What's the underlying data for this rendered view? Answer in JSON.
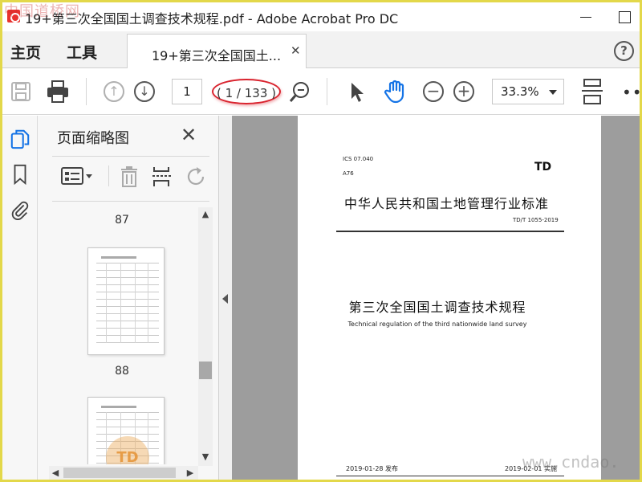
{
  "watermark": {
    "top_left": "中国道桥网",
    "bottom_right": "www.cndao."
  },
  "window": {
    "title": "19+第三次全国国土调查技术规程.pdf - Adobe Acrobat Pro DC"
  },
  "tabs": {
    "home": "主页",
    "tools": "工具",
    "document": "19+第三次全国国土...",
    "help": "?"
  },
  "toolbar": {
    "page_current": "1",
    "page_total": "( 1 / 133 )",
    "zoom": "33.3%",
    "icons": [
      "save-icon",
      "print-icon",
      "page-up-icon",
      "page-down-icon",
      "search-zoom-icon",
      "select-cursor-icon",
      "hand-tool-icon",
      "zoom-out-icon",
      "zoom-in-icon",
      "fit-page-icon",
      "more-icon"
    ]
  },
  "sidebar": {
    "title": "页面缩略图",
    "page_labels": [
      "87",
      "88"
    ]
  },
  "document_page": {
    "ics": "ICS 07.040",
    "class": "A76",
    "td": "TD",
    "standard_title": "中华人民共和国土地管理行业标准",
    "standard_code": "TD/T 1055-2019",
    "main_title": "第三次全国国土调查技术规程",
    "english_title": "Technical regulation of the third nationwide land survey",
    "published": "2019-01-28 发布",
    "implemented": "2019-02-01 实施"
  },
  "thumbnail_watermark": "TD",
  "colors": {
    "accent": "#1473e6",
    "highlight_ring": "#d9232e",
    "frame": "#e3d84a"
  }
}
